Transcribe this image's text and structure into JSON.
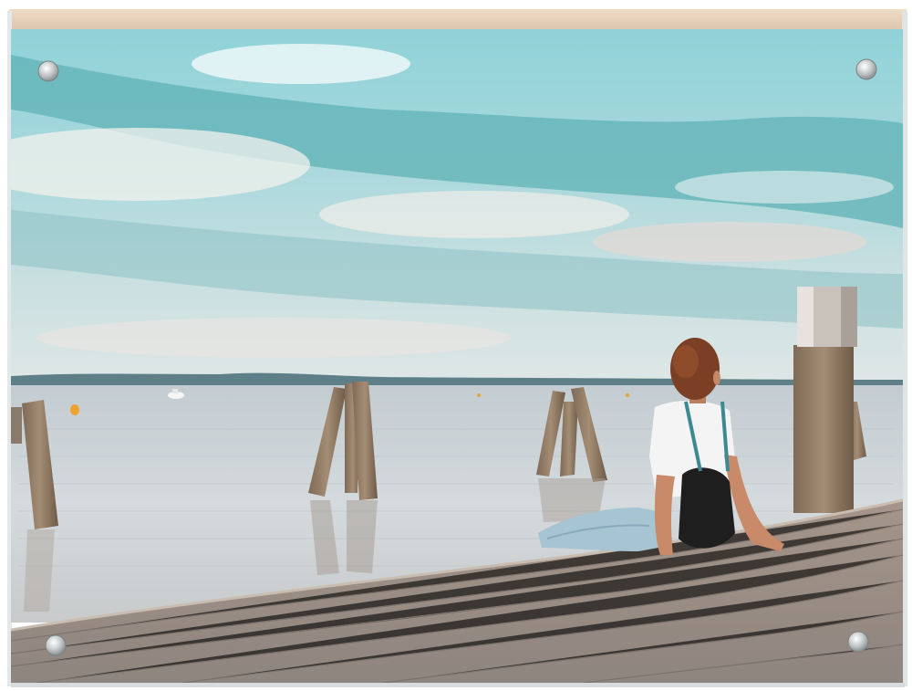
{
  "product": {
    "type": "acrylic-block-photo-frame",
    "edge_color": "#e9d5bf",
    "standoff_count": 4
  },
  "photo": {
    "sky_colors": [
      "#8fd2d8",
      "#5fb3b9",
      "#dfe6e4"
    ],
    "water_color": "#c9d3d6",
    "dock_color": "#9c8f86",
    "subject": {
      "top_color": "#f4f4f4",
      "jeans_color": "#a7c4d3",
      "backpack_color": "#1e1e1e",
      "hair_color": "#7a3f24"
    }
  }
}
